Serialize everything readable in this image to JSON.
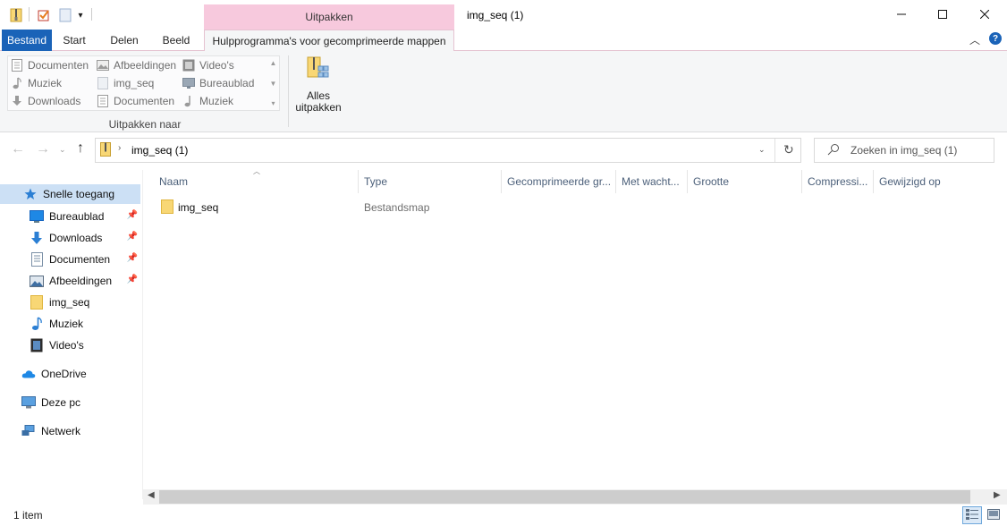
{
  "window": {
    "title": "img_seq (1)",
    "context_tab_group": "Uitpakken"
  },
  "tabs": [
    {
      "label": "Bestand"
    },
    {
      "label": "Start"
    },
    {
      "label": "Delen"
    },
    {
      "label": "Beeld"
    },
    {
      "label": "Hulpprogramma's voor gecomprimeerde mappen"
    }
  ],
  "ribbon": {
    "gallery": [
      {
        "label": "Documenten",
        "icon": "documents-icon"
      },
      {
        "label": "Afbeeldingen",
        "icon": "pictures-icon"
      },
      {
        "label": "Video's",
        "icon": "videos-icon"
      },
      {
        "label": "Muziek",
        "icon": "music-icon"
      },
      {
        "label": "img_seq",
        "icon": "folder-icon"
      },
      {
        "label": "Bureaublad",
        "icon": "desktop-icon"
      },
      {
        "label": "Downloads",
        "icon": "downloads-icon"
      },
      {
        "label": "Documenten",
        "icon": "documents-icon"
      },
      {
        "label": "Muziek",
        "icon": "music-icon"
      }
    ],
    "group_label": "Uitpakken naar",
    "extract_all_line1": "Alles",
    "extract_all_line2": "uitpakken"
  },
  "address": {
    "path": "img_seq (1)",
    "search_placeholder": "Zoeken in img_seq (1)"
  },
  "sidebar": {
    "items": [
      {
        "label": "Snelle toegang",
        "icon": "star-icon",
        "pinned": false
      },
      {
        "label": "Bureaublad",
        "icon": "desktop-icon",
        "pinned": true
      },
      {
        "label": "Downloads",
        "icon": "downloads-icon",
        "pinned": true
      },
      {
        "label": "Documenten",
        "icon": "documents-icon",
        "pinned": true
      },
      {
        "label": "Afbeeldingen",
        "icon": "pictures-icon",
        "pinned": true
      },
      {
        "label": "img_seq",
        "icon": "folder-icon",
        "pinned": false
      },
      {
        "label": "Muziek",
        "icon": "music-icon",
        "pinned": false
      },
      {
        "label": "Video's",
        "icon": "videos-icon",
        "pinned": false
      },
      {
        "label": "OneDrive",
        "icon": "onedrive-icon",
        "pinned": false
      },
      {
        "label": "Deze pc",
        "icon": "this-pc-icon",
        "pinned": false
      },
      {
        "label": "Netwerk",
        "icon": "network-icon",
        "pinned": false
      }
    ]
  },
  "columns": [
    "Naam",
    "Type",
    "Gecomprimeerde gr...",
    "Met wacht...",
    "Grootte",
    "Compressi...",
    "Gewijzigd op"
  ],
  "files": [
    {
      "name": "img_seq",
      "type": "Bestandsmap"
    }
  ],
  "status": {
    "item_count": "1 item"
  },
  "colors": {
    "accent": "#1a63b8",
    "context_tab": "#f7c9dd",
    "selection": "#cce0f5",
    "folder": "#f8d775"
  }
}
